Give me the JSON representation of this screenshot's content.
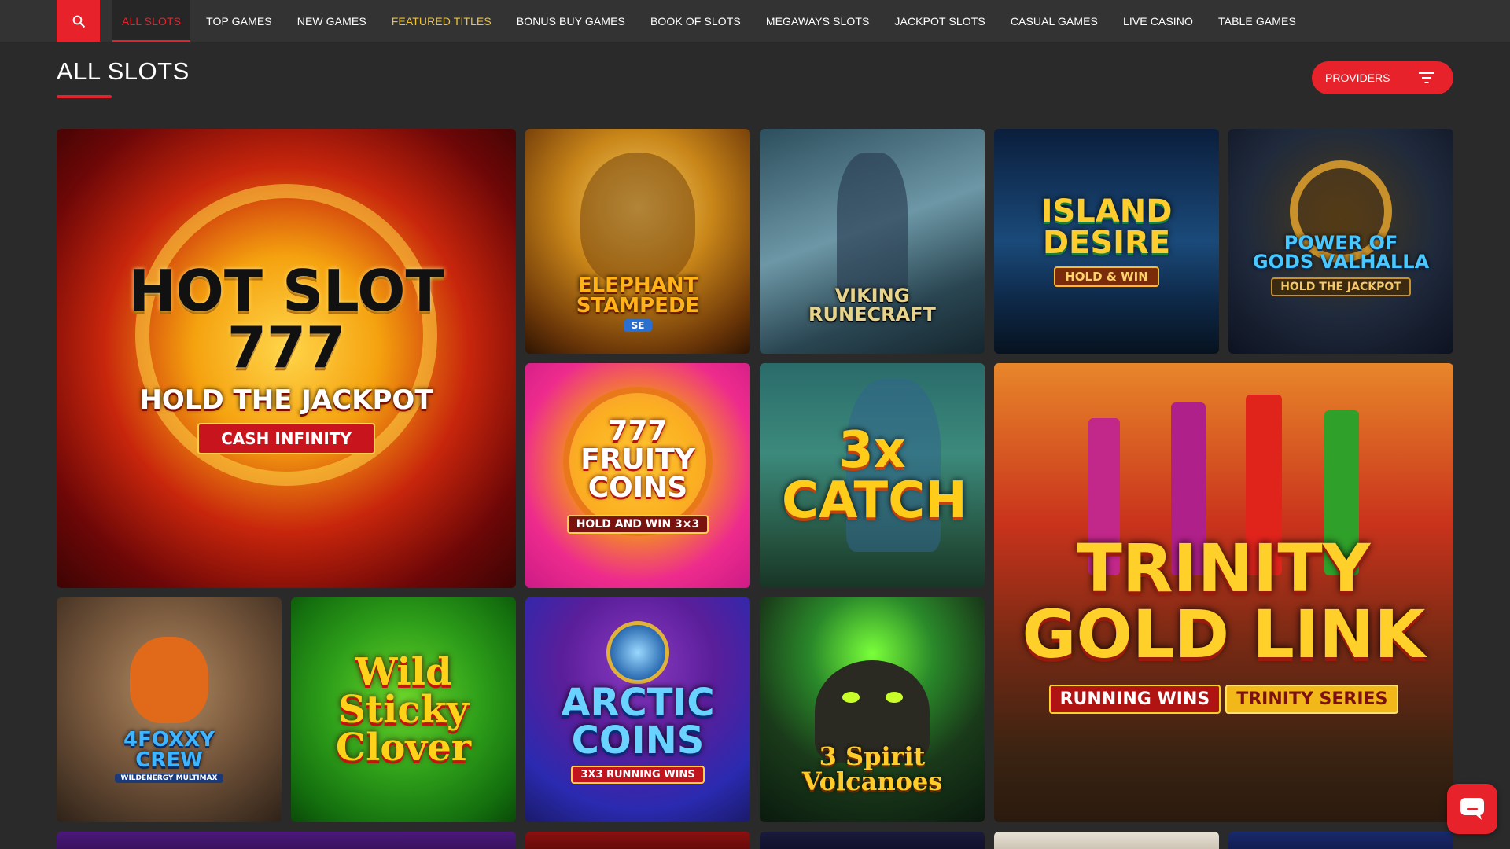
{
  "nav": {
    "items": [
      {
        "label": "ALL SLOTS",
        "state": "active"
      },
      {
        "label": "TOP GAMES",
        "state": ""
      },
      {
        "label": "NEW GAMES",
        "state": ""
      },
      {
        "label": "FEATURED TITLES",
        "state": "featured"
      },
      {
        "label": "BONUS BUY GAMES",
        "state": ""
      },
      {
        "label": "BOOK OF SLOTS",
        "state": ""
      },
      {
        "label": "MEGAWAYS SLOTS",
        "state": ""
      },
      {
        "label": "JACKPOT SLOTS",
        "state": ""
      },
      {
        "label": "CASUAL GAMES",
        "state": ""
      },
      {
        "label": "LIVE CASINO",
        "state": ""
      },
      {
        "label": "TABLE GAMES",
        "state": ""
      }
    ],
    "search_icon": "search-icon"
  },
  "header": {
    "title": "ALL SLOTS",
    "providers_label": "PROVIDERS",
    "filter_icon": "filter-icon"
  },
  "games": {
    "hot_slot": {
      "title": "HOT SLOT 777",
      "subtitle": "HOLD THE JACKPOT",
      "tag": "CASH INFINITY"
    },
    "elephant": {
      "title": "ELEPHANT STAMPEDE",
      "tag": "SE"
    },
    "viking": {
      "title": "VIKING RUNECRAFT"
    },
    "island": {
      "title": "ISLAND DESIRE",
      "tag": "HOLD & WIN"
    },
    "valhalla": {
      "title": "POWER OF GODS VALHALLA",
      "tag": "HOLD THE JACKPOT"
    },
    "fruity": {
      "title": "777 FRUITY COINS",
      "tag": "HOLD AND WIN 3×3"
    },
    "catch": {
      "title": "3x CATCH"
    },
    "trinity": {
      "title": "TRINITY GOLD LINK",
      "tag1": "RUNNING WINS",
      "tag2": "TRINITY SERIES"
    },
    "foxxy": {
      "title": "4FOXXY CREW",
      "tag": "WILDENERGY MULTIMAX"
    },
    "clover": {
      "title": "Wild Sticky Clover"
    },
    "arctic": {
      "title": "ARCTIC COINS",
      "tag": "3X3 RUNNING WINS"
    },
    "volcanoes": {
      "title": "3 Spirit Volcanoes"
    }
  },
  "colors": {
    "accent": "#e8222a",
    "featured": "#f2c230",
    "background": "#2a2a2a",
    "nav_bg": "#333333"
  },
  "chat_icon": "chat-bubble-icon"
}
